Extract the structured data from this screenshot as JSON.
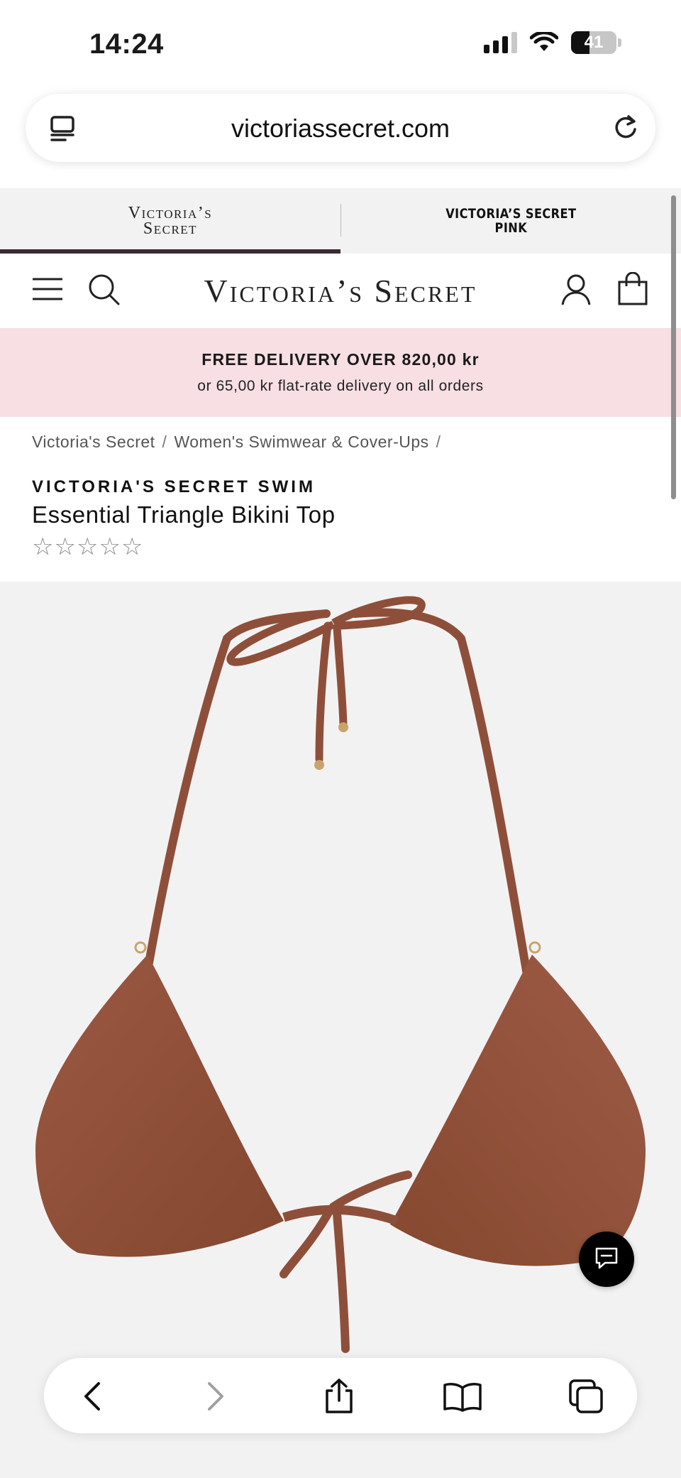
{
  "status_bar": {
    "time": "14:24",
    "battery": "41"
  },
  "browser": {
    "url": "victoriassecret.com"
  },
  "brand_tabs": {
    "vs_line1": "Victoria’s",
    "vs_line2": "Secret",
    "pink_line1": "VICTORIA’S SECRET",
    "pink_line2": "PINK"
  },
  "header": {
    "logo": "Victoria’s Secret"
  },
  "promo": {
    "main": "FREE DELIVERY OVER 820,00 kr",
    "sub": "or 65,00 kr flat-rate delivery on all orders"
  },
  "breadcrumbs": [
    "Victoria's Secret",
    "/",
    "Women's Swimwear & Cover-Ups",
    "/"
  ],
  "product": {
    "brand": "VICTORIA'S SECRET SWIM",
    "title": "Essential Triangle Bikini Top",
    "rating_stars": 5,
    "rating_value": 0,
    "image_color": "#8e4f3a"
  },
  "icons": {
    "tabs": "tabs-icon",
    "reload": "reload-icon",
    "menu": "menu-icon",
    "search": "search-icon",
    "account": "account-icon",
    "bag": "shopping-bag-icon",
    "chat": "chat-icon",
    "back": "back-icon",
    "forward": "forward-icon",
    "share": "share-icon",
    "bookmarks": "bookmarks-icon",
    "tab_switcher": "tab-switcher-icon"
  }
}
